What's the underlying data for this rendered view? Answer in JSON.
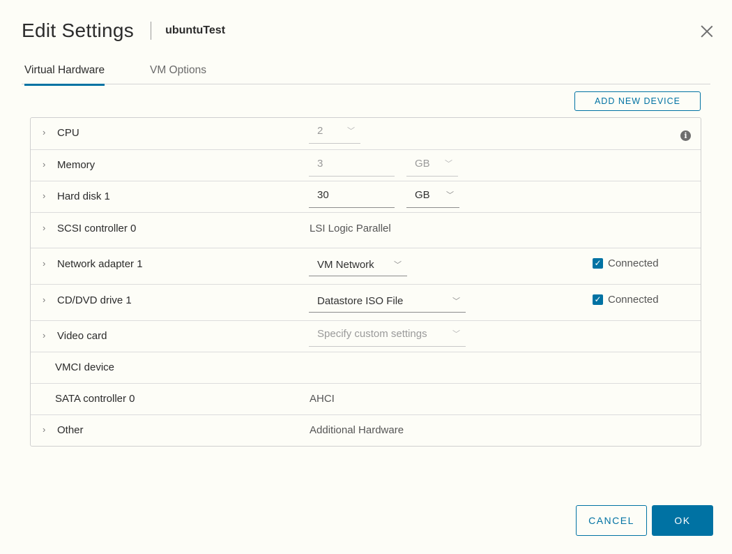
{
  "dialog": {
    "title": "Edit Settings",
    "vm_name": "ubuntuTest",
    "tabs": [
      {
        "label": "Virtual Hardware",
        "active": true
      },
      {
        "label": "VM Options",
        "active": false
      }
    ],
    "add_device_label": "ADD NEW DEVICE",
    "cancel_label": "CANCEL",
    "ok_label": "OK"
  },
  "hardware": {
    "cpu": {
      "label": "CPU",
      "value": "2"
    },
    "memory": {
      "label": "Memory",
      "value": "3",
      "unit": "GB"
    },
    "hard_disk": {
      "label": "Hard disk 1",
      "value": "30",
      "unit": "GB"
    },
    "scsi": {
      "label": "SCSI controller 0",
      "value": "LSI Logic Parallel"
    },
    "network": {
      "label": "Network adapter 1",
      "value": "VM Network",
      "connected_label": "Connected",
      "connected": true
    },
    "cddvd": {
      "label": "CD/DVD drive 1",
      "value": "Datastore ISO File",
      "connected_label": "Connected",
      "connected": true
    },
    "video": {
      "label": "Video card",
      "value": "Specify custom settings"
    },
    "vmci": {
      "label": "VMCI device"
    },
    "sata": {
      "label": "SATA controller 0",
      "value": "AHCI"
    },
    "other": {
      "label": "Other",
      "value": "Additional Hardware"
    }
  },
  "icons": {
    "expand": "›",
    "dropdown": "﹀",
    "check": "✓",
    "info": "i"
  },
  "colors": {
    "accent": "#0072a3",
    "background": "#fdfdf7"
  }
}
